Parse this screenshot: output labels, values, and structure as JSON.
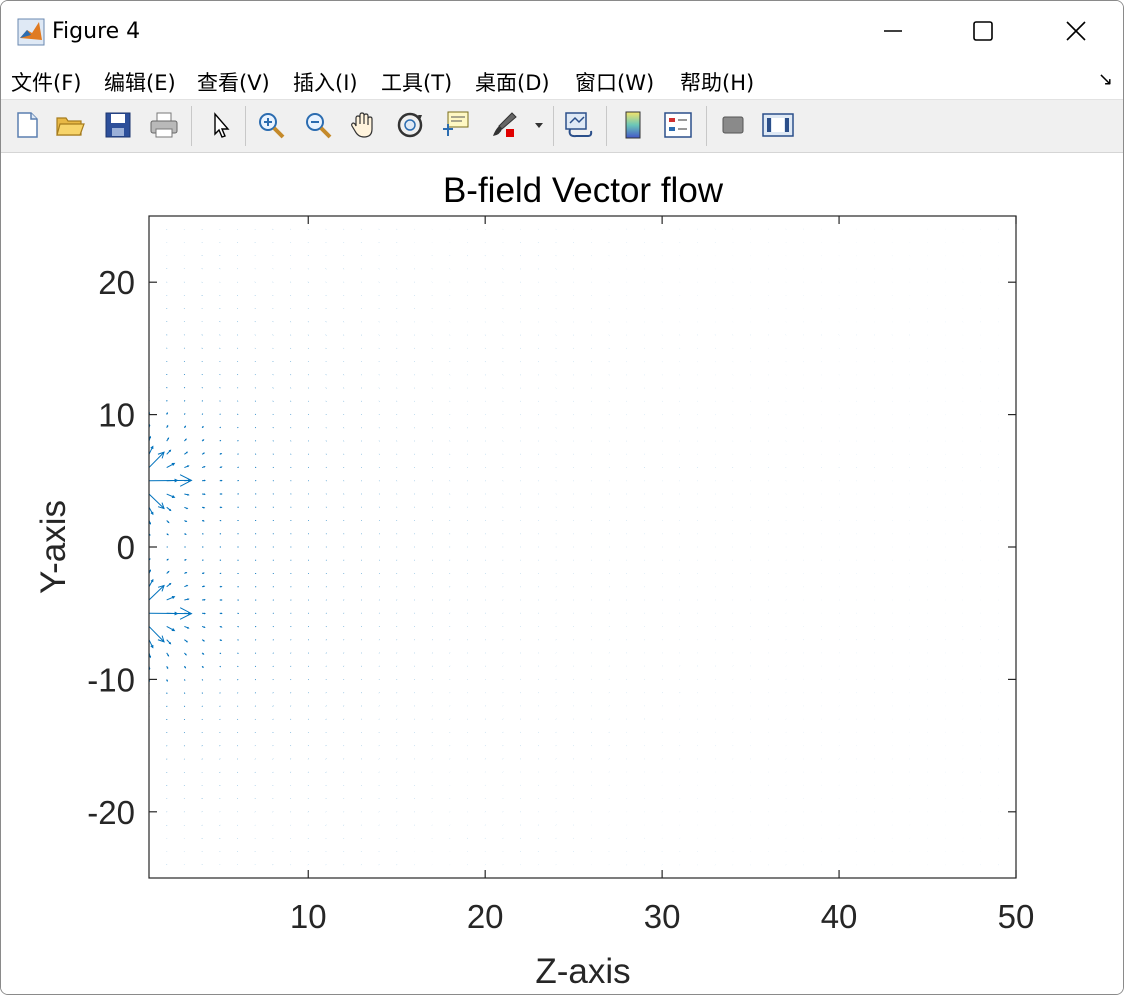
{
  "window": {
    "title": "Figure 4"
  },
  "menu": [
    "文件(F)",
    "编辑(E)",
    "查看(V)",
    "插入(I)",
    "工具(T)",
    "桌面(D)",
    "窗口(W)",
    "帮助(H)"
  ],
  "toolbar": {
    "items": [
      "new-figure-icon",
      "open-file-icon",
      "save-icon",
      "print-icon",
      "edit-plot-arrow-icon",
      "zoom-in-icon",
      "zoom-out-icon",
      "pan-hand-icon",
      "rotate-3d-icon",
      "data-cursor-icon",
      "brush-icon",
      "link-plot-icon",
      "insert-colorbar-icon",
      "insert-legend-icon",
      "hide-plot-tools-icon",
      "show-plot-tools-icon"
    ]
  },
  "colors": {
    "accent": "#0072bd",
    "window_border": "#8a8a8a",
    "toolbar_bg": "#f0f0f0"
  },
  "chart_data": {
    "type": "quiver",
    "title": "B-field Vector flow",
    "xlabel": "Z-axis",
    "ylabel": "Y-axis",
    "xlim": [
      1,
      50
    ],
    "ylim": [
      -25,
      25
    ],
    "xticks": [
      10,
      20,
      30,
      40,
      50
    ],
    "yticks": [
      -20,
      -10,
      0,
      10,
      20
    ],
    "grid": false,
    "field": {
      "x_range": [
        1,
        50
      ],
      "y_range": [
        -25,
        25
      ],
      "step": 1,
      "sources_y": [
        5,
        -5
      ],
      "source_z": 0
    },
    "color": "#0072bd"
  }
}
